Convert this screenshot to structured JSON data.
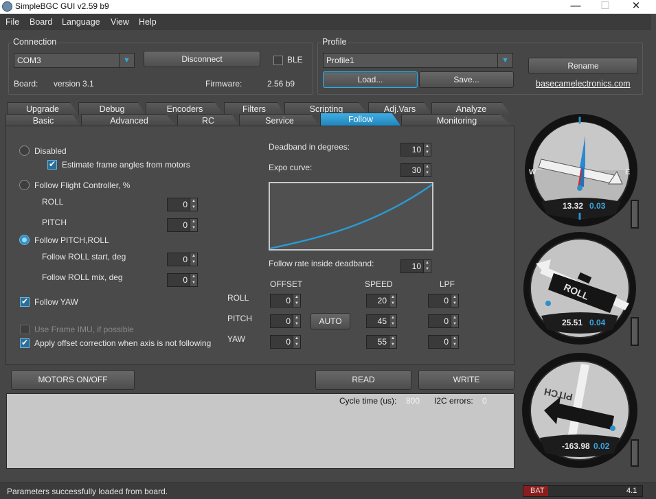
{
  "window": {
    "title": "SimpleBGC GUI v2.59 b9",
    "min_glyph": "—",
    "max_glyph": "☐",
    "close_glyph": "✕"
  },
  "menu": [
    "File",
    "Board",
    "Language",
    "View",
    "Help"
  ],
  "connection": {
    "label": "Connection",
    "port": "COM3",
    "disconnect_label": "Disconnect",
    "ble_label": "BLE",
    "board_label": "Board:",
    "board_value": "version 3.1",
    "firmware_label": "Firmware:",
    "firmware_value": "2.56 b9"
  },
  "profile": {
    "label": "Profile",
    "selected": "Profile1",
    "load_label": "Load...",
    "save_label": "Save...",
    "rename_label": "Rename",
    "link": "basecamelectronics.com"
  },
  "tabs_top": [
    "Upgrade",
    "Debug",
    "Encoders",
    "Filters",
    "Scripting",
    "Adj.Vars",
    "Analyze"
  ],
  "tabs_bottom": [
    "Basic",
    "Advanced",
    "RC",
    "Service",
    "Follow",
    "Monitoring"
  ],
  "follow": {
    "disabled_label": "Disabled",
    "estimate_label": "Estimate frame angles from motors",
    "follow_fc_label": "Follow Flight Controller, %",
    "roll_label": "ROLL",
    "roll_value": "0",
    "pitch_label": "PITCH",
    "pitch_value": "0",
    "follow_pitch_roll_label": "Follow PITCH,ROLL",
    "roll_start_label": "Follow ROLL start, deg",
    "roll_start_value": "0",
    "roll_mix_label": "Follow ROLL mix, deg",
    "roll_mix_value": "0",
    "follow_yaw_label": "Follow YAW",
    "use_frame_imu_label": "Use Frame IMU, if possible",
    "apply_offset_label": "Apply offset correction when axis is not following",
    "deadband_label": "Deadband in degrees:",
    "deadband_value": "10",
    "expo_label": "Expo curve:",
    "expo_value": "30",
    "rate_label": "Follow rate inside deadband:",
    "rate_value": "10",
    "col_offset": "OFFSET",
    "col_speed": "SPEED",
    "col_lpf": "LPF",
    "row_roll": "ROLL",
    "row_pitch": "PITCH",
    "row_yaw": "YAW",
    "auto_label": "AUTO",
    "offset": [
      "0",
      "0",
      "0"
    ],
    "speed": [
      "20",
      "45",
      "55"
    ],
    "lpf": [
      "0",
      "0",
      "0"
    ]
  },
  "actions": {
    "motors_label": "MOTORS ON/OFF",
    "read_label": "READ",
    "write_label": "WRITE"
  },
  "log": {
    "cycle_label": "Cycle time (us):",
    "cycle_value": "800",
    "i2c_label": "I2C errors:",
    "i2c_value": "0"
  },
  "status": {
    "message": "Parameters successfully loaded from board.",
    "bat_label": "BAT",
    "bat_value": "4.1"
  },
  "gauges": {
    "yaw": {
      "value": "13.32",
      "rate": "0.03",
      "west": "W",
      "east": "E"
    },
    "roll": {
      "value": "25.51",
      "rate": "0.04",
      "label": "ROLL"
    },
    "pitch": {
      "value": "-163.98",
      "rate": "0.02",
      "label": "PITCH"
    }
  },
  "colors": {
    "accent": "#2a90c8",
    "background": "#464646",
    "panel": "#4a4a4a"
  }
}
